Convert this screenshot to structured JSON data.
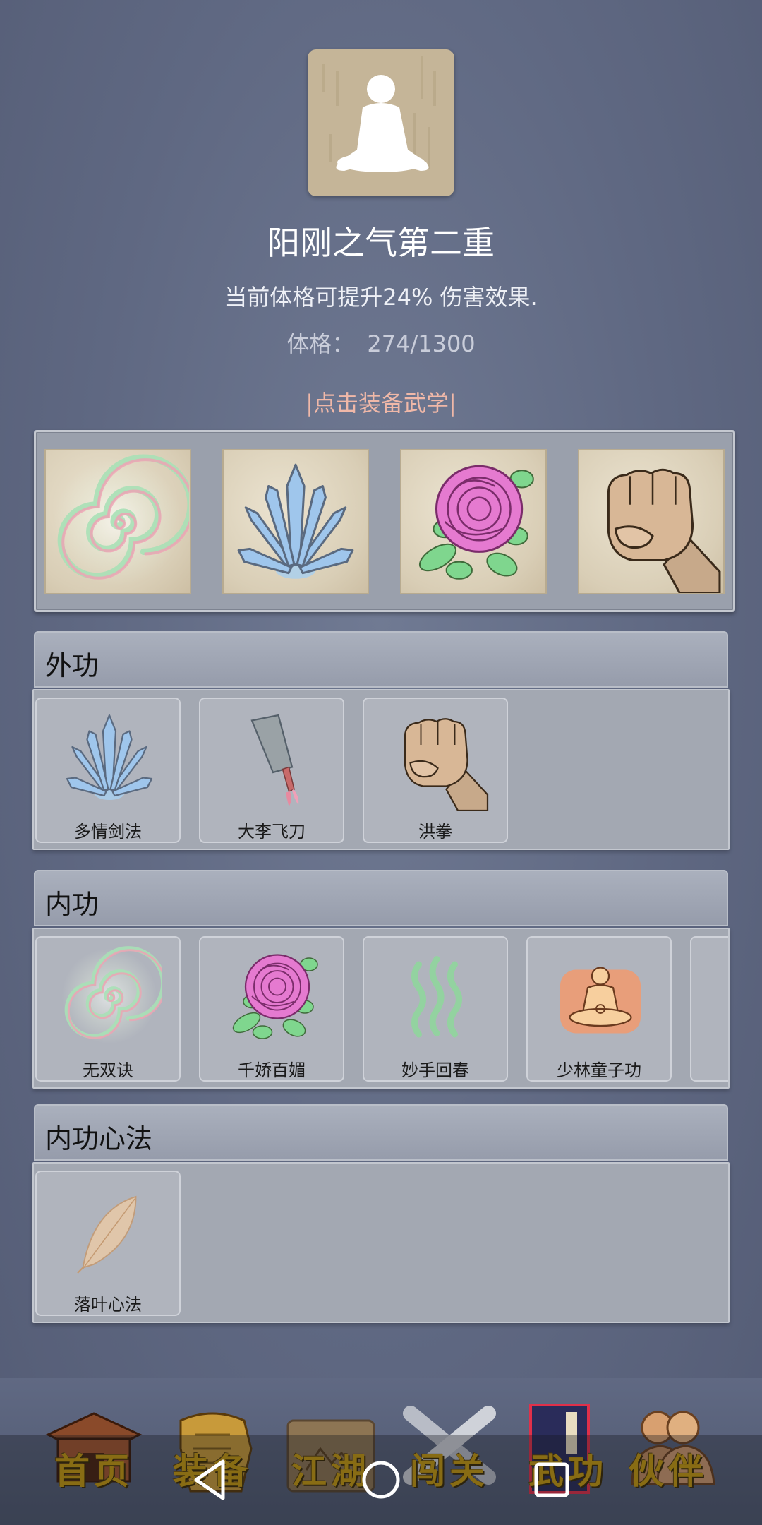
{
  "header": {
    "skill_title": "阳刚之气第二重",
    "description": "当前体格可提升24% 伤害效果.",
    "stat_label": "体格：",
    "stat_value": "274/1300",
    "equip_link": "|点击装备武学|"
  },
  "equipped_slots": [
    {
      "icon": "swirl-icon"
    },
    {
      "icon": "sword-fan-icon"
    },
    {
      "icon": "rose-icon"
    },
    {
      "icon": "fist-icon"
    }
  ],
  "sections": {
    "external": {
      "title": "外功",
      "skills": [
        {
          "name": "多情剑法",
          "icon": "sword-fan-icon"
        },
        {
          "name": "大李飞刀",
          "icon": "cleaver-icon"
        },
        {
          "name": "洪拳",
          "icon": "fist-icon"
        }
      ]
    },
    "internal": {
      "title": "内功",
      "skills": [
        {
          "name": "无双诀",
          "icon": "swirl-icon"
        },
        {
          "name": "千娇百媚",
          "icon": "rose-icon"
        },
        {
          "name": "妙手回春",
          "icon": "green-waves-icon"
        },
        {
          "name": "少林童子功",
          "icon": "meditation-icon"
        }
      ]
    },
    "mind": {
      "title": "内功心法",
      "skills": [
        {
          "name": "落叶心法",
          "icon": "leaf-icon"
        }
      ]
    }
  },
  "tabs": [
    {
      "label": "首页",
      "icon": "temple-icon"
    },
    {
      "label": "装备",
      "icon": "armor-icon"
    },
    {
      "label": "江湖",
      "icon": "scroll-map-icon"
    },
    {
      "label": "闯关",
      "icon": "crossed-swords-icon"
    },
    {
      "label": "武功",
      "icon": "book-icon"
    },
    {
      "label": "伙伴",
      "icon": "companions-icon"
    }
  ],
  "navbar": {
    "back": "back-triangle-icon",
    "home": "home-circle-icon",
    "recents": "recents-square-icon"
  }
}
